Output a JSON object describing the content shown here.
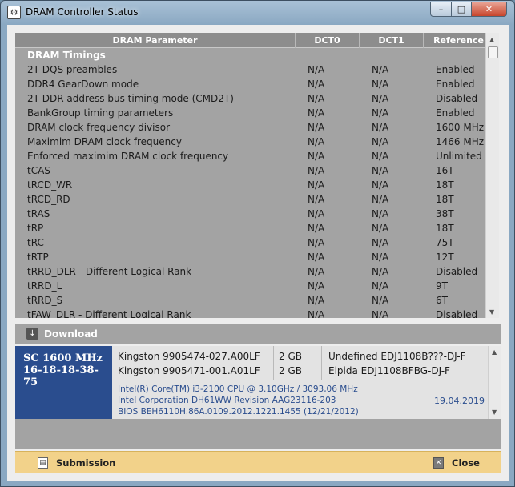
{
  "window": {
    "title": "DRAM Controller Status",
    "icon": "app-icon",
    "minimize": "–",
    "maximize": "□",
    "close": "✕"
  },
  "table": {
    "headers": [
      "DRAM Parameter",
      "DCT0",
      "DCT1",
      "Reference"
    ],
    "group_title": "DRAM Timings",
    "rows": [
      [
        "2T DQS preambles",
        "N/A",
        "N/A",
        "Enabled"
      ],
      [
        "DDR4 GearDown mode",
        "N/A",
        "N/A",
        "Enabled"
      ],
      [
        "2T DDR address bus timing mode (CMD2T)",
        "N/A",
        "N/A",
        "Disabled"
      ],
      [
        "BankGroup timing parameters",
        "N/A",
        "N/A",
        "Enabled"
      ],
      [
        "DRAM clock frequency divisor",
        "N/A",
        "N/A",
        "1600 MHz"
      ],
      [
        "Maximim DRAM clock frequency",
        "N/A",
        "N/A",
        "1466 MHz"
      ],
      [
        "Enforced maximim DRAM clock frequency",
        "N/A",
        "N/A",
        "Unlimited"
      ],
      [
        "tCAS",
        "N/A",
        "N/A",
        "16T"
      ],
      [
        "tRCD_WR",
        "N/A",
        "N/A",
        "18T"
      ],
      [
        "tRCD_RD",
        "N/A",
        "N/A",
        "18T"
      ],
      [
        "tRAS",
        "N/A",
        "N/A",
        "38T"
      ],
      [
        "tRP",
        "N/A",
        "N/A",
        "18T"
      ],
      [
        "tRC",
        "N/A",
        "N/A",
        "75T"
      ],
      [
        "tRTP",
        "N/A",
        "N/A",
        "12T"
      ],
      [
        "tRRD_DLR - Different Logical Rank",
        "N/A",
        "N/A",
        "Disabled"
      ],
      [
        "tRRD_L",
        "N/A",
        "N/A",
        "9T"
      ],
      [
        "tRRD_S",
        "N/A",
        "N/A",
        "6T"
      ],
      [
        "tFAW_DLR - Different Logical Rank",
        "N/A",
        "N/A",
        "Disabled"
      ]
    ]
  },
  "download": {
    "label": "Download",
    "icon": "download-icon"
  },
  "modules": {
    "speed": "SC 1600 MHz",
    "timings": "16-18-18-38-75",
    "rows": [
      [
        "Kingston 9905474-027.A00LF",
        "2 GB",
        "Undefined EDJ1108B???-DJ-F"
      ],
      [
        "Kingston 9905471-001.A01LF",
        "2 GB",
        "Elpida EDJ1108BFBG-DJ-F"
      ]
    ],
    "cpu": "Intel(R) Core(TM) i3-2100 CPU @ 3.10GHz / 3093,06 MHz",
    "board": "Intel Corporation DH61WW Revision AAG23116-203",
    "bios": "BIOS BEH6110H.86A.0109.2012.1221.1455 (12/21/2012)",
    "date": "19.04.2019"
  },
  "footer": {
    "submission": "Submission",
    "close": "Close"
  }
}
